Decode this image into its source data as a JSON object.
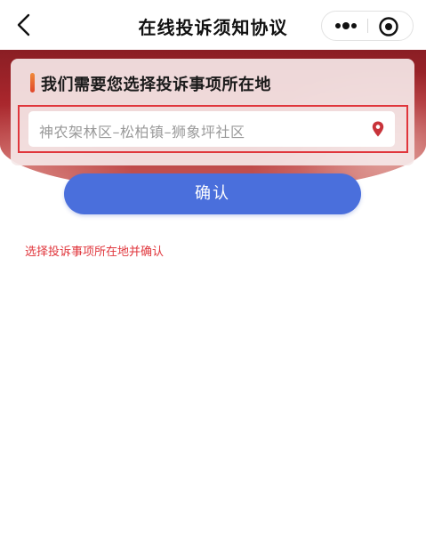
{
  "navbar": {
    "title": "在线投诉须知协议",
    "back_icon": "chevron-left-icon",
    "more_icon": "more-dots-icon",
    "close_icon": "target-close-icon"
  },
  "card": {
    "title": "我们需要您选择投诉事项所在地",
    "location_value": "神农架林区–松柏镇–狮象坪社区",
    "location_icon": "location-pin-icon",
    "highlight_color": "#e0363c"
  },
  "confirm_button": {
    "label": "确认",
    "color": "#4a6fdc"
  },
  "instruction": {
    "text": "选择投诉事项所在地并确认",
    "color": "#e0363c"
  },
  "theme": {
    "banner_color": "#a8262c"
  }
}
